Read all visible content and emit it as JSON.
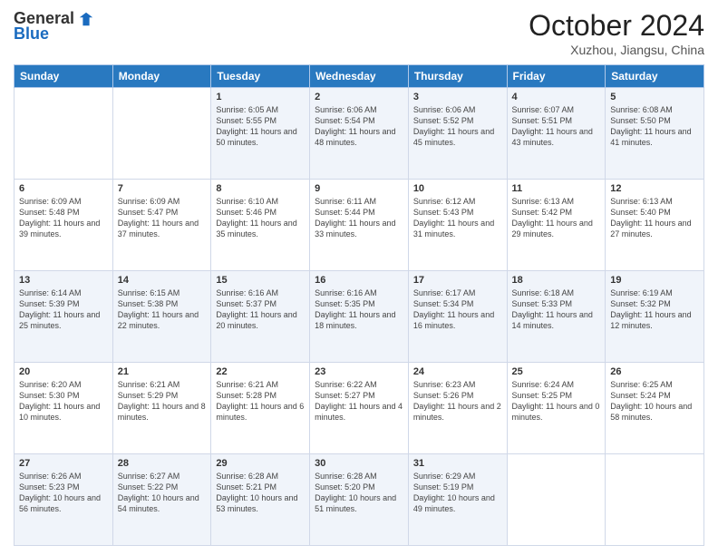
{
  "header": {
    "logo_general": "General",
    "logo_blue": "Blue",
    "title": "October 2024",
    "subtitle": "Xuzhou, Jiangsu, China"
  },
  "days_of_week": [
    "Sunday",
    "Monday",
    "Tuesday",
    "Wednesday",
    "Thursday",
    "Friday",
    "Saturday"
  ],
  "weeks": [
    [
      {
        "day": "",
        "info": ""
      },
      {
        "day": "",
        "info": ""
      },
      {
        "day": "1",
        "info": "Sunrise: 6:05 AM\nSunset: 5:55 PM\nDaylight: 11 hours and 50 minutes."
      },
      {
        "day": "2",
        "info": "Sunrise: 6:06 AM\nSunset: 5:54 PM\nDaylight: 11 hours and 48 minutes."
      },
      {
        "day": "3",
        "info": "Sunrise: 6:06 AM\nSunset: 5:52 PM\nDaylight: 11 hours and 45 minutes."
      },
      {
        "day": "4",
        "info": "Sunrise: 6:07 AM\nSunset: 5:51 PM\nDaylight: 11 hours and 43 minutes."
      },
      {
        "day": "5",
        "info": "Sunrise: 6:08 AM\nSunset: 5:50 PM\nDaylight: 11 hours and 41 minutes."
      }
    ],
    [
      {
        "day": "6",
        "info": "Sunrise: 6:09 AM\nSunset: 5:48 PM\nDaylight: 11 hours and 39 minutes."
      },
      {
        "day": "7",
        "info": "Sunrise: 6:09 AM\nSunset: 5:47 PM\nDaylight: 11 hours and 37 minutes."
      },
      {
        "day": "8",
        "info": "Sunrise: 6:10 AM\nSunset: 5:46 PM\nDaylight: 11 hours and 35 minutes."
      },
      {
        "day": "9",
        "info": "Sunrise: 6:11 AM\nSunset: 5:44 PM\nDaylight: 11 hours and 33 minutes."
      },
      {
        "day": "10",
        "info": "Sunrise: 6:12 AM\nSunset: 5:43 PM\nDaylight: 11 hours and 31 minutes."
      },
      {
        "day": "11",
        "info": "Sunrise: 6:13 AM\nSunset: 5:42 PM\nDaylight: 11 hours and 29 minutes."
      },
      {
        "day": "12",
        "info": "Sunrise: 6:13 AM\nSunset: 5:40 PM\nDaylight: 11 hours and 27 minutes."
      }
    ],
    [
      {
        "day": "13",
        "info": "Sunrise: 6:14 AM\nSunset: 5:39 PM\nDaylight: 11 hours and 25 minutes."
      },
      {
        "day": "14",
        "info": "Sunrise: 6:15 AM\nSunset: 5:38 PM\nDaylight: 11 hours and 22 minutes."
      },
      {
        "day": "15",
        "info": "Sunrise: 6:16 AM\nSunset: 5:37 PM\nDaylight: 11 hours and 20 minutes."
      },
      {
        "day": "16",
        "info": "Sunrise: 6:16 AM\nSunset: 5:35 PM\nDaylight: 11 hours and 18 minutes."
      },
      {
        "day": "17",
        "info": "Sunrise: 6:17 AM\nSunset: 5:34 PM\nDaylight: 11 hours and 16 minutes."
      },
      {
        "day": "18",
        "info": "Sunrise: 6:18 AM\nSunset: 5:33 PM\nDaylight: 11 hours and 14 minutes."
      },
      {
        "day": "19",
        "info": "Sunrise: 6:19 AM\nSunset: 5:32 PM\nDaylight: 11 hours and 12 minutes."
      }
    ],
    [
      {
        "day": "20",
        "info": "Sunrise: 6:20 AM\nSunset: 5:30 PM\nDaylight: 11 hours and 10 minutes."
      },
      {
        "day": "21",
        "info": "Sunrise: 6:21 AM\nSunset: 5:29 PM\nDaylight: 11 hours and 8 minutes."
      },
      {
        "day": "22",
        "info": "Sunrise: 6:21 AM\nSunset: 5:28 PM\nDaylight: 11 hours and 6 minutes."
      },
      {
        "day": "23",
        "info": "Sunrise: 6:22 AM\nSunset: 5:27 PM\nDaylight: 11 hours and 4 minutes."
      },
      {
        "day": "24",
        "info": "Sunrise: 6:23 AM\nSunset: 5:26 PM\nDaylight: 11 hours and 2 minutes."
      },
      {
        "day": "25",
        "info": "Sunrise: 6:24 AM\nSunset: 5:25 PM\nDaylight: 11 hours and 0 minutes."
      },
      {
        "day": "26",
        "info": "Sunrise: 6:25 AM\nSunset: 5:24 PM\nDaylight: 10 hours and 58 minutes."
      }
    ],
    [
      {
        "day": "27",
        "info": "Sunrise: 6:26 AM\nSunset: 5:23 PM\nDaylight: 10 hours and 56 minutes."
      },
      {
        "day": "28",
        "info": "Sunrise: 6:27 AM\nSunset: 5:22 PM\nDaylight: 10 hours and 54 minutes."
      },
      {
        "day": "29",
        "info": "Sunrise: 6:28 AM\nSunset: 5:21 PM\nDaylight: 10 hours and 53 minutes."
      },
      {
        "day": "30",
        "info": "Sunrise: 6:28 AM\nSunset: 5:20 PM\nDaylight: 10 hours and 51 minutes."
      },
      {
        "day": "31",
        "info": "Sunrise: 6:29 AM\nSunset: 5:19 PM\nDaylight: 10 hours and 49 minutes."
      },
      {
        "day": "",
        "info": ""
      },
      {
        "day": "",
        "info": ""
      }
    ]
  ]
}
